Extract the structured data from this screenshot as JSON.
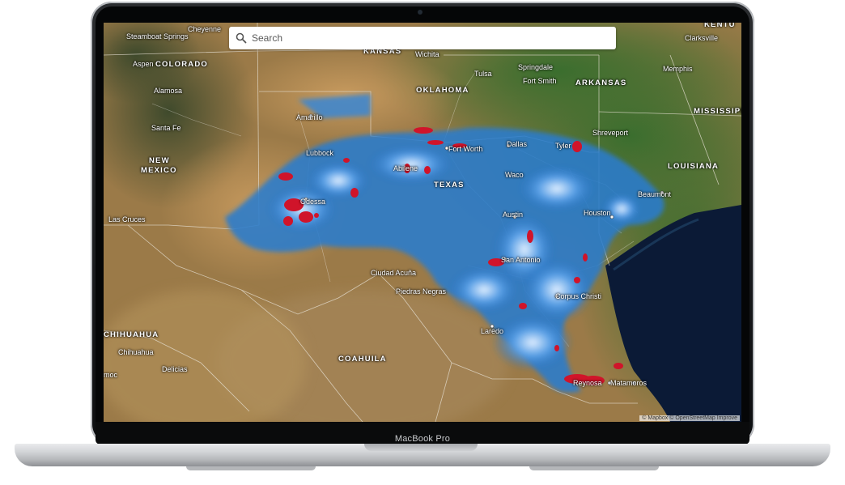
{
  "device": {
    "label": "MacBook Pro"
  },
  "search": {
    "placeholder": "Search",
    "icon": "search-icon"
  },
  "attribution": "© Mapbox © OpenStreetMap Improve",
  "colors": {
    "heat_low": "#1f6fc4",
    "heat_mid": "#e9f3ff",
    "heat_high": "#d0142a",
    "gulf": "#0b1a36"
  },
  "labels": [
    {
      "id": "steamboat-springs",
      "text": "Steamboat Springs",
      "kind": "city"
    },
    {
      "id": "cheyenne",
      "text": "Cheyenne",
      "kind": "city"
    },
    {
      "id": "aspen",
      "text": "Aspen",
      "kind": "city"
    },
    {
      "id": "colorado",
      "text": "COLORADO",
      "kind": "state"
    },
    {
      "id": "kansas",
      "text": "KANSAS",
      "kind": "state"
    },
    {
      "id": "wichita",
      "text": "Wichita",
      "kind": "city"
    },
    {
      "id": "tulsa",
      "text": "Tulsa",
      "kind": "city"
    },
    {
      "id": "springdale",
      "text": "Springdale",
      "kind": "city"
    },
    {
      "id": "fort-smith",
      "text": "Fort Smith",
      "kind": "city"
    },
    {
      "id": "arkansas",
      "text": "ARKANSAS",
      "kind": "state"
    },
    {
      "id": "clarksville",
      "text": "Clarksville",
      "kind": "city"
    },
    {
      "id": "memphis",
      "text": "Memphis",
      "kind": "city"
    },
    {
      "id": "kentucky",
      "text": "KENTU",
      "kind": "state"
    },
    {
      "id": "oklahoma",
      "text": "OKLAHOMA",
      "kind": "state"
    },
    {
      "id": "alamosa",
      "text": "Alamosa",
      "kind": "city"
    },
    {
      "id": "amarillo",
      "text": "Amarillo",
      "kind": "city"
    },
    {
      "id": "santa-fe",
      "text": "Santa Fe",
      "kind": "city"
    },
    {
      "id": "mississippi",
      "text": "MISSISSIPPI",
      "kind": "state"
    },
    {
      "id": "shreveport",
      "text": "Shreveport",
      "kind": "city"
    },
    {
      "id": "fort-worth",
      "text": "Fort Worth",
      "kind": "city"
    },
    {
      "id": "dallas",
      "text": "Dallas",
      "kind": "city"
    },
    {
      "id": "tyler",
      "text": "Tyler",
      "kind": "city"
    },
    {
      "id": "lubbock",
      "text": "Lubbock",
      "kind": "city"
    },
    {
      "id": "new-mexico-1",
      "text": "NEW",
      "kind": "state"
    },
    {
      "id": "new-mexico-2",
      "text": "MEXICO",
      "kind": "state"
    },
    {
      "id": "abilene",
      "text": "Abilene",
      "kind": "city"
    },
    {
      "id": "louisiana",
      "text": "LOUISIANA",
      "kind": "state"
    },
    {
      "id": "waco",
      "text": "Waco",
      "kind": "city"
    },
    {
      "id": "texas",
      "text": "TEXAS",
      "kind": "state"
    },
    {
      "id": "odessa",
      "text": "Odessa",
      "kind": "city"
    },
    {
      "id": "beaumont",
      "text": "Beaumont",
      "kind": "city"
    },
    {
      "id": "las-cruces",
      "text": "Las Cruces",
      "kind": "city"
    },
    {
      "id": "austin",
      "text": "Austin",
      "kind": "city"
    },
    {
      "id": "houston",
      "text": "Houston",
      "kind": "city"
    },
    {
      "id": "san-antonio",
      "text": "San Antonio",
      "kind": "city"
    },
    {
      "id": "ciudad-acuna",
      "text": "Ciudad Acuña",
      "kind": "city"
    },
    {
      "id": "piedras-negras",
      "text": "Piedras Negras",
      "kind": "city"
    },
    {
      "id": "corpus-christi",
      "text": "Corpus Christi",
      "kind": "city"
    },
    {
      "id": "chihuahua-state",
      "text": "CHIHUAHUA",
      "kind": "state"
    },
    {
      "id": "laredo",
      "text": "Laredo",
      "kind": "city"
    },
    {
      "id": "chihuahua-city",
      "text": "Chihuahua",
      "kind": "city"
    },
    {
      "id": "coahuila",
      "text": "COAHUILA",
      "kind": "state"
    },
    {
      "id": "delicias",
      "text": "Delicias",
      "kind": "city"
    },
    {
      "id": "cuauhtemoc",
      "text": "moc",
      "kind": "city"
    },
    {
      "id": "reynosa",
      "text": "Reynosa",
      "kind": "city"
    },
    {
      "id": "matamoros",
      "text": "Matamoros",
      "kind": "city"
    }
  ]
}
